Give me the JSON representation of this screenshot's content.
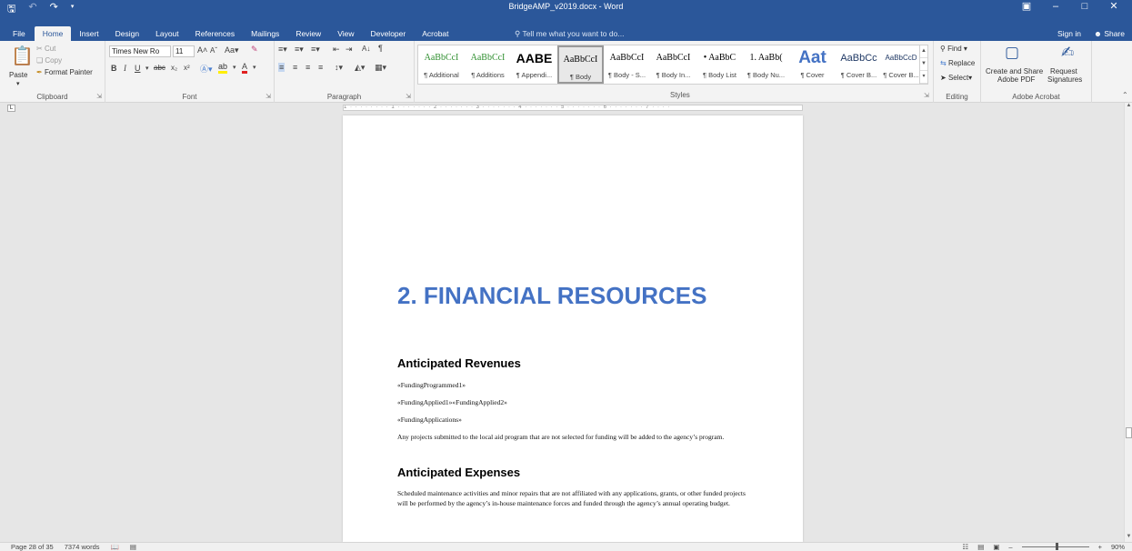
{
  "title_bar": {
    "title": "BridgeAMP_v2019.docx - Word",
    "save_icon": "save-icon",
    "undo_icon": "undo-icon",
    "redo_icon": "redo-icon"
  },
  "tabs": [
    "File",
    "Home",
    "Insert",
    "Design",
    "Layout",
    "References",
    "Mailings",
    "Review",
    "View",
    "Developer",
    "Acrobat"
  ],
  "active_tab": "Home",
  "tell_me": "Tell me what you want to do...",
  "sign_in": "Sign in",
  "share": "Share",
  "clipboard": {
    "paste": "Paste",
    "cut": "Cut",
    "copy": "Copy",
    "format_painter": "Format Painter",
    "label": "Clipboard"
  },
  "font": {
    "name": "Times New Ro",
    "size": "11",
    "label": "Font"
  },
  "paragraph": {
    "label": "Paragraph"
  },
  "styles": {
    "label": "Styles",
    "items": [
      {
        "preview": "AaBbCcI",
        "name": "¶ Additional"
      },
      {
        "preview": "AaBbCcI",
        "name": "¶ Additions"
      },
      {
        "preview": "AABE",
        "name": "¶ Appendi..."
      },
      {
        "preview": "AaBbCcI",
        "name": "¶ Body"
      },
      {
        "preview": "AaBbCcI",
        "name": "¶ Body - S..."
      },
      {
        "preview": "AaBbCcI",
        "name": "¶ Body In..."
      },
      {
        "preview": "• AaBbC",
        "name": "¶ Body List"
      },
      {
        "preview": "1. AaBb(",
        "name": "¶ Body Nu..."
      },
      {
        "preview": "Aat",
        "name": "¶ Cover"
      },
      {
        "preview": "AaBbCc",
        "name": "¶ Cover B..."
      },
      {
        "preview": "AaBbCcD",
        "name": "¶ Cover B..."
      }
    ],
    "selected_index": 3
  },
  "editing": {
    "find": "Find",
    "replace": "Replace",
    "select": "Select",
    "label": "Editing"
  },
  "acrobat": {
    "create_share": "Create and Share",
    "create_share_2": "Adobe PDF",
    "request": "Request",
    "request_2": "Signatures",
    "label": "Adobe Acrobat"
  },
  "ruler_text": "1 · · · · · · · · 1 · · · · · · · 2 · · · · · · · 3 · · · · · · · 4 · · · · · · · 5 · · · · · · · 6 · · · · · · · 7 · · · ·",
  "document": {
    "heading1": "2. FINANCIAL RESOURCES",
    "heading_revenues": "Anticipated Revenues",
    "field1": "«FundingProgrammed1»",
    "field2": "«FundingApplied1»«FundingApplied2»",
    "field3": "«FundingApplications»",
    "para_revenue": "Any projects submitted to the local aid program that are not selected for funding will be added to the agency’s program.",
    "heading_expenses": "Anticipated Expenses",
    "para_expenses": "Scheduled maintenance activities and minor repairs that are not affiliated with any applications, grants, or other funded projects will be performed by the agency’s in-house maintenance forces and funded through the agency’s annual operating budget."
  },
  "status": {
    "page": "Page 28 of 35",
    "words": "7374 words",
    "zoom": "90%"
  }
}
